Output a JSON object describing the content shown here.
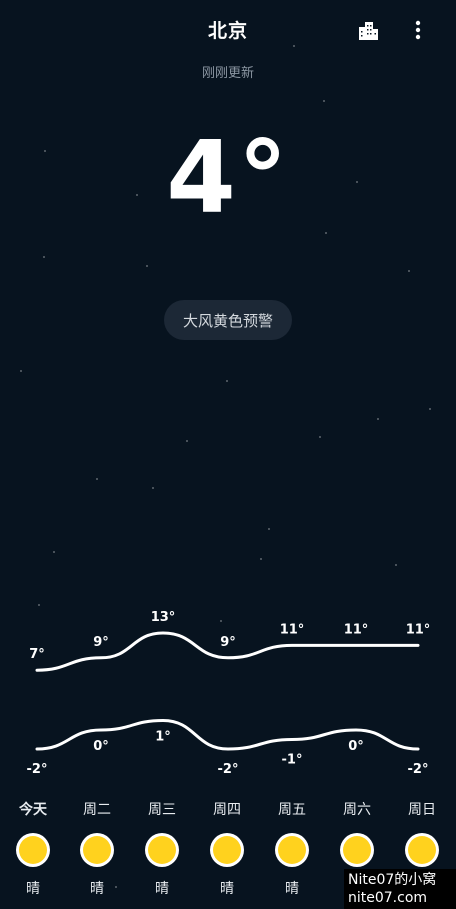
{
  "header": {
    "city": "北京",
    "update_text": "刚刚更新",
    "city_icon": "city-buildings-icon",
    "more_icon": "more-vertical-icon"
  },
  "current": {
    "temperature": "4°"
  },
  "alert": {
    "text": "大风黄色预警"
  },
  "forecast": [
    {
      "day": "今天",
      "high": "7°",
      "low": "-2°",
      "condition": "晴",
      "icon": "sunny-icon"
    },
    {
      "day": "周二",
      "high": "9°",
      "low": "0°",
      "condition": "晴",
      "icon": "sunny-icon"
    },
    {
      "day": "周三",
      "high": "13°",
      "low": "1°",
      "condition": "晴",
      "icon": "sunny-icon"
    },
    {
      "day": "周四",
      "high": "9°",
      "low": "-2°",
      "condition": "晴",
      "icon": "sunny-icon"
    },
    {
      "day": "周五",
      "high": "11°",
      "low": "-1°",
      "condition": "晴",
      "icon": "sunny-icon"
    },
    {
      "day": "周六",
      "high": "11°",
      "low": "0°",
      "condition": "晴",
      "icon": "sunny-icon"
    },
    {
      "day": "周日",
      "high": "11°",
      "low": "-2°",
      "condition": "晴",
      "icon": "sunny-icon"
    }
  ],
  "chart_data": {
    "type": "line",
    "categories": [
      "今天",
      "周二",
      "周三",
      "周四",
      "周五",
      "周六",
      "周日"
    ],
    "series": [
      {
        "values": [
          7,
          9,
          13,
          9,
          11,
          11,
          11
        ]
      },
      {
        "values": [
          -2,
          0,
          1,
          -2,
          -1,
          0,
          -2
        ]
      }
    ]
  },
  "watermark": {
    "line1": "Nite07的小窝",
    "line2": "nite07.com"
  },
  "colors": {
    "background": "#07131f",
    "sun": "#ffd21e",
    "alert_bg": "#1c2836"
  }
}
